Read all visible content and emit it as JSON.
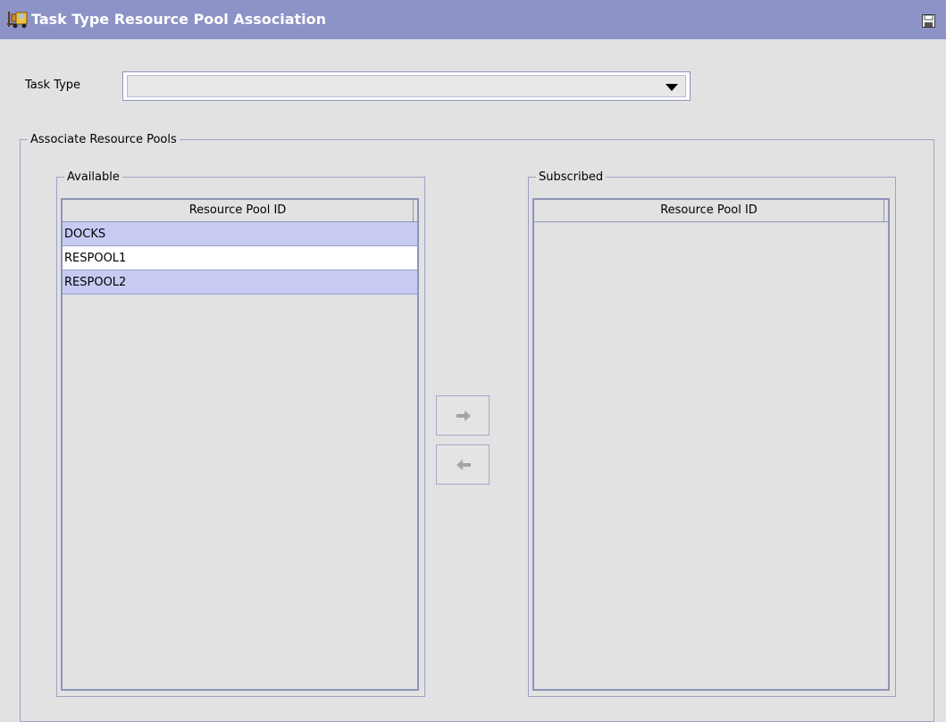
{
  "window": {
    "title": "Task Type Resource Pool Association",
    "title_bar_color": "#8d93c7"
  },
  "icons": {
    "title": "forklift-icon",
    "save": "save-icon",
    "dropdown": "dropdown-arrow-icon",
    "move_right": "arrow-right-icon",
    "move_left": "arrow-left-icon"
  },
  "task_type": {
    "label": "Task Type",
    "value": ""
  },
  "associate": {
    "legend": "Associate Resource Pools"
  },
  "available": {
    "legend": "Available",
    "column_header": "Resource Pool ID",
    "rows": [
      {
        "id": "DOCKS",
        "selected": true
      },
      {
        "id": "RESPOOL1",
        "selected": false
      },
      {
        "id": "RESPOOL2",
        "selected": true
      }
    ]
  },
  "subscribed": {
    "legend": "Subscribed",
    "column_header": "Resource Pool ID",
    "rows": []
  },
  "colors": {
    "selected_row": "#c7cbf4",
    "border": "#8e93b9",
    "background": "#e2e2e2"
  }
}
